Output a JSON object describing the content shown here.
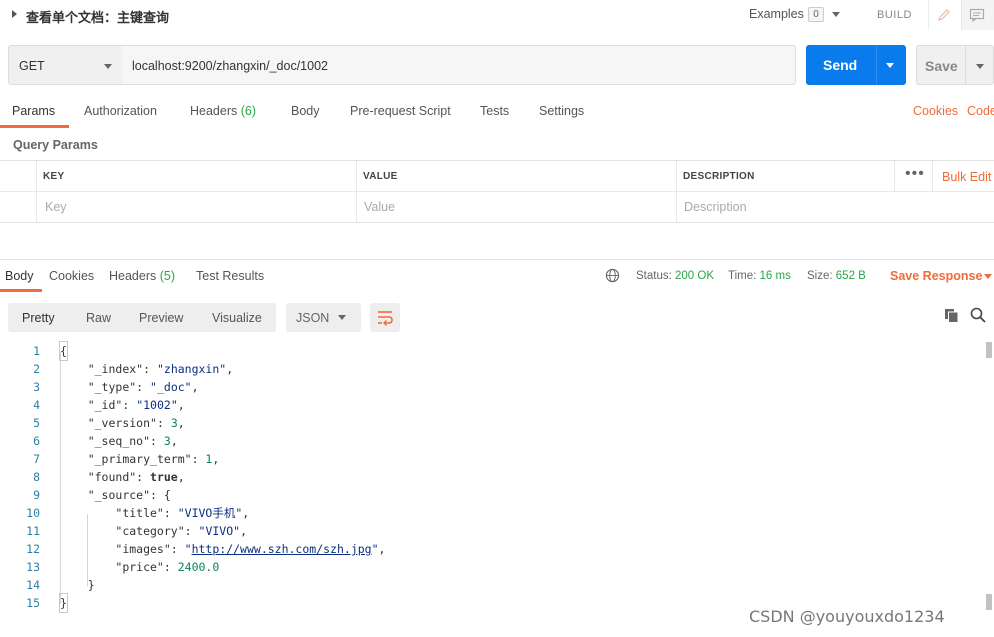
{
  "header": {
    "title": "查看单个文档：主键查询",
    "examples_label": "Examples",
    "examples_count": "0",
    "build_label": "BUILD"
  },
  "request": {
    "method": "GET",
    "url": "localhost:9200/zhangxin/_doc/1002",
    "send_label": "Send",
    "save_label": "Save"
  },
  "request_tabs": [
    {
      "label": "Params",
      "active": true
    },
    {
      "label": "Authorization"
    },
    {
      "label": "Headers ",
      "count": "(6)"
    },
    {
      "label": "Body"
    },
    {
      "label": "Pre-request Script"
    },
    {
      "label": "Tests"
    },
    {
      "label": "Settings"
    }
  ],
  "links": {
    "cookies": "Cookies",
    "code": "Code"
  },
  "query_params": {
    "label": "Query Params",
    "headers": {
      "key": "KEY",
      "value": "VALUE",
      "description": "DESCRIPTION"
    },
    "placeholders": {
      "key": "Key",
      "value": "Value",
      "description": "Description"
    },
    "more_label": "•••",
    "bulk_edit": "Bulk Edit"
  },
  "response": {
    "tabs": [
      {
        "label": "Body",
        "active": true
      },
      {
        "label": "Cookies"
      },
      {
        "label": "Headers ",
        "count": "(5)"
      },
      {
        "label": "Test Results"
      }
    ],
    "status_label": "Status:",
    "status_value": "200 OK",
    "time_label": "Time:",
    "time_value": "16 ms",
    "size_label": "Size:",
    "size_value": "652 B",
    "save_response": "Save Response",
    "view_modes": [
      "Pretty",
      "Raw",
      "Preview",
      "Visualize"
    ],
    "format": "JSON",
    "body": {
      "_index": "zhangxin",
      "_type": "_doc",
      "_id": "1002",
      "_version": "3",
      "_seq_no": "3",
      "_primary_term": "1",
      "found": "true",
      "source_title": "VIVO手机",
      "source_category": "VIVO",
      "source_images": "http://www.szh.com/szh.jpg",
      "source_price": "2400.0"
    }
  },
  "watermark": "CSDN @youyouxdo1234"
}
